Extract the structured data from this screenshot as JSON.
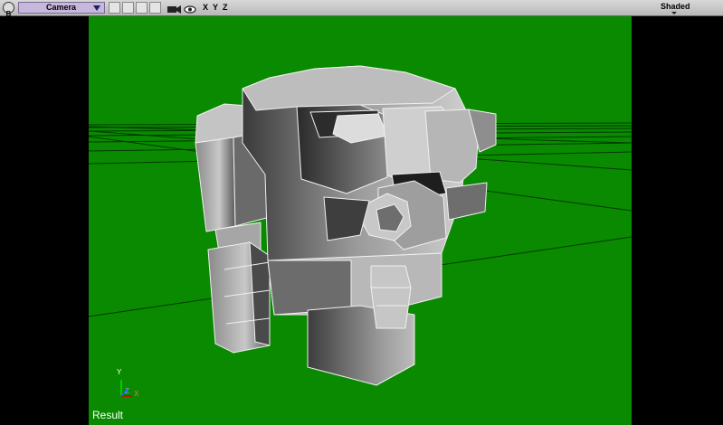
{
  "toolbar": {
    "badge_letter": "B",
    "view_menu_label": "Camera",
    "axis_x": "X",
    "axis_y": "Y",
    "axis_z": "Z",
    "shading_label": "Shaded",
    "icons": [
      "panel-badge-icon",
      "dropdown-arrow-icon",
      "layout-slot-icon",
      "camera-icon",
      "eye-icon",
      "shading-dropdown-icon"
    ]
  },
  "viewport": {
    "background_color": "#0a8a00",
    "result_label": "Result",
    "axis_gizmo": {
      "y": "Y",
      "z": "Z",
      "x": "X"
    }
  },
  "colors": {
    "toolbar_bg": "#c8c8c8",
    "view_menu_bg": "#c6b8dc",
    "viewport_green": "#0a8a00",
    "letterbox": "#000000"
  }
}
